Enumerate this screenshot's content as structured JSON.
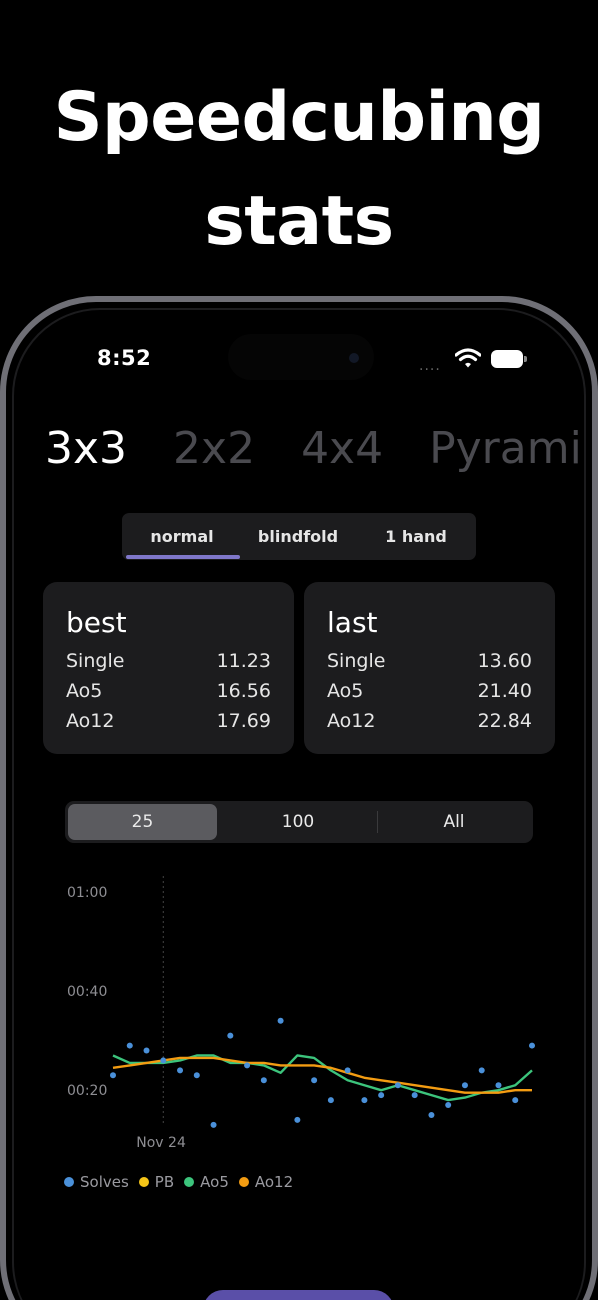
{
  "headline": {
    "line1": "Speedcubing",
    "line2": "stats"
  },
  "status_bar": {
    "time": "8:52",
    "signal": "....",
    "wifi_icon": "wifi-icon",
    "battery_icon": "battery-icon"
  },
  "puzzle_tabs": [
    {
      "label": "3x3",
      "active": true
    },
    {
      "label": "2x2",
      "active": false
    },
    {
      "label": "4x4",
      "active": false
    },
    {
      "label": "Pyraminx",
      "active": false
    }
  ],
  "mode_tabs": [
    {
      "label": "normal",
      "active": true
    },
    {
      "label": "blindfold",
      "active": false
    },
    {
      "label": "1 hand",
      "active": false
    }
  ],
  "best": {
    "title": "best",
    "rows": [
      {
        "label": "Single",
        "value": "11.23"
      },
      {
        "label": "Ao5",
        "value": "16.56"
      },
      {
        "label": "Ao12",
        "value": "17.69"
      }
    ]
  },
  "last": {
    "title": "last",
    "rows": [
      {
        "label": "Single",
        "value": "13.60"
      },
      {
        "label": "Ao5",
        "value": "21.40"
      },
      {
        "label": "Ao12",
        "value": "22.84"
      }
    ]
  },
  "range_tabs": [
    {
      "label": "25",
      "active": true
    },
    {
      "label": "100",
      "active": false
    },
    {
      "label": "All",
      "active": false
    }
  ],
  "colors": {
    "accent": "#7f77c9",
    "solves": "#4a90d9",
    "pb": "#f5c518",
    "ao5": "#3cc47c",
    "ao12": "#f39c12",
    "button": "#5a4fa8"
  },
  "chart_data": {
    "type": "scatter",
    "y_ticks": [
      "01:00",
      "00:40",
      "00:20"
    ],
    "y_tick_values": [
      60,
      40,
      20
    ],
    "ylim": [
      16,
      62
    ],
    "x_marker_label": "Nov 24",
    "x_marker_index": 3,
    "series": [
      {
        "name": "Solves",
        "kind": "points",
        "values": [
          23,
          29,
          28,
          26,
          24,
          23,
          13,
          31,
          25,
          22,
          34,
          14,
          22,
          18,
          24,
          18,
          19,
          21,
          19,
          15,
          17,
          21,
          24,
          21,
          18,
          29
        ]
      },
      {
        "name": "PB",
        "kind": "line",
        "values": []
      },
      {
        "name": "Ao5",
        "kind": "line",
        "values": [
          27,
          25.5,
          25.5,
          25.5,
          26,
          27,
          27,
          25.5,
          25.5,
          25,
          23.5,
          27,
          26.5,
          24,
          22,
          21,
          20,
          21,
          20,
          19,
          18,
          18.5,
          19.5,
          20,
          21,
          24
        ]
      },
      {
        "name": "Ao12",
        "kind": "line",
        "values": [
          24.5,
          25,
          25.5,
          26,
          26.5,
          26.5,
          26.5,
          26,
          25.5,
          25.5,
          25,
          25,
          25,
          24.5,
          23.5,
          22.5,
          22,
          21.5,
          21,
          20.5,
          20,
          19.5,
          19.5,
          19.5,
          20,
          20
        ]
      }
    ]
  },
  "legend": [
    {
      "name": "Solves",
      "color": "#4a90d9"
    },
    {
      "name": "PB",
      "color": "#f5c518"
    },
    {
      "name": "Ao5",
      "color": "#3cc47c"
    },
    {
      "name": "Ao12",
      "color": "#f39c12"
    }
  ]
}
